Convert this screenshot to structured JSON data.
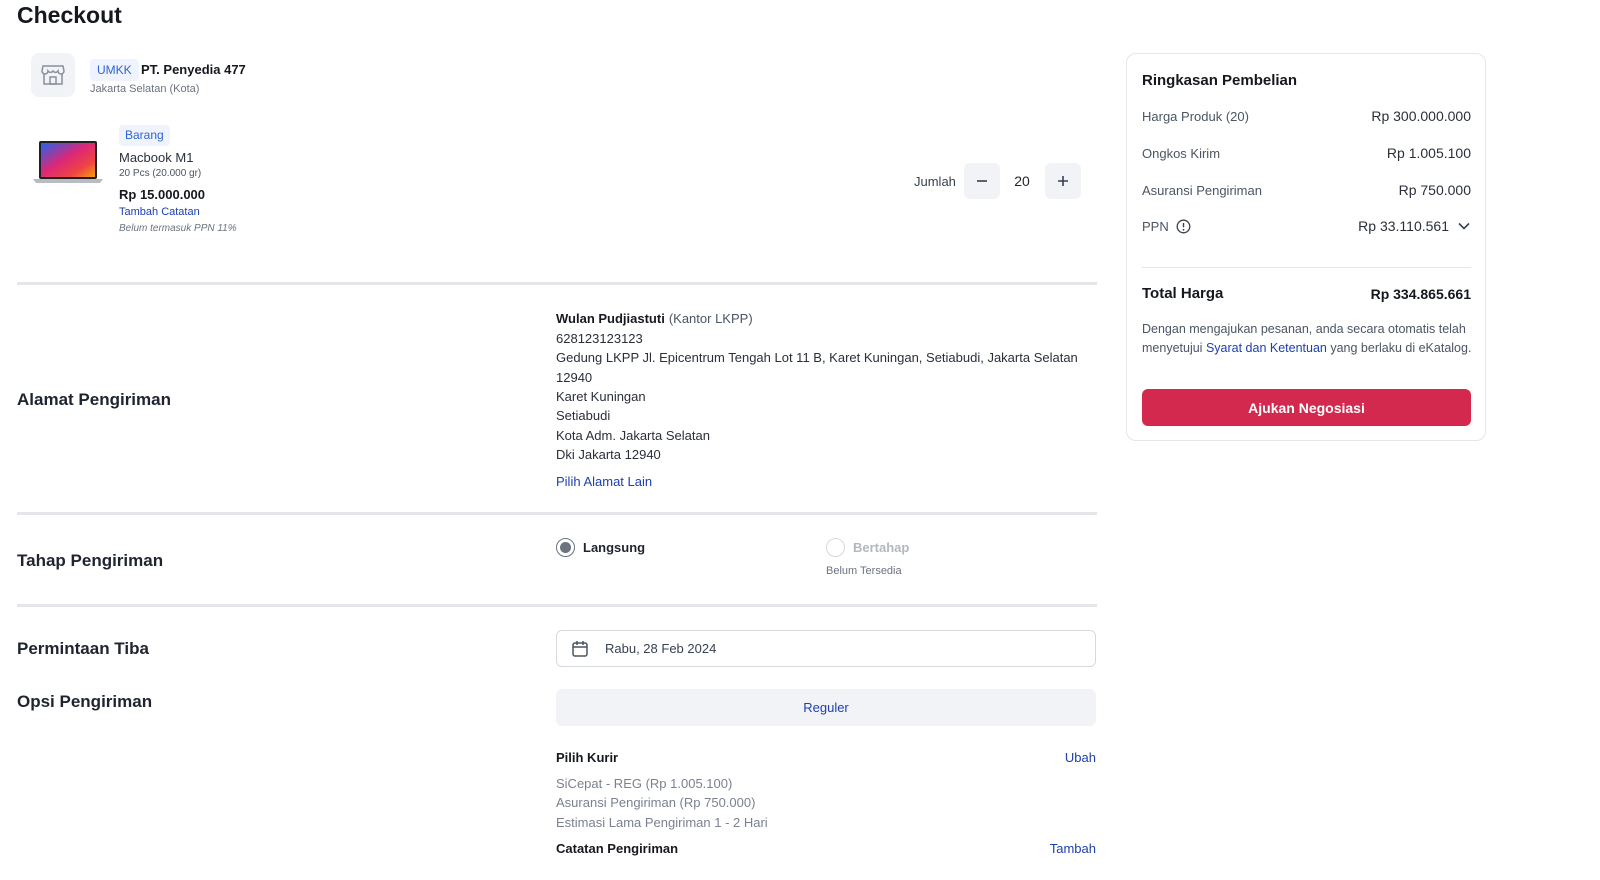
{
  "page": {
    "title": "Checkout"
  },
  "seller": {
    "badge": "UMKK",
    "name": "PT. Penyedia 477",
    "location": "Jakarta Selatan (Kota)"
  },
  "product": {
    "badge": "Barang",
    "name": "Macbook M1",
    "quantity_info": "20 Pcs (20.000 gr)",
    "price": "Rp 15.000.000",
    "add_note": "Tambah Catatan",
    "tax_note": "Belum termasuk PPN 11%",
    "qty_label": "Jumlah",
    "qty_value": "20"
  },
  "address": {
    "section_label": "Alamat Pengiriman",
    "name": "Wulan Pudjiastuti",
    "office": "(Kantor LKPP)",
    "phone": "628123123123",
    "street_line1": "Gedung LKPP Jl. Epicentrum Tengah Lot 11 B, Karet Kuningan, Setiabudi, Jakarta Selatan",
    "street_line2": "12940",
    "village": "Karet Kuningan",
    "district": "Setiabudi",
    "city": "Kota Adm. Jakarta Selatan",
    "province": "Dki Jakarta 12940",
    "change_link": "Pilih Alamat Lain"
  },
  "shipping_stage": {
    "section_label": "Tahap Pengiriman",
    "option_direct": "Langsung",
    "option_staged": "Bertahap",
    "staged_note": "Belum Tersedia"
  },
  "arrival": {
    "section_label": "Permintaan Tiba",
    "date": "Rabu, 28 Feb 2024"
  },
  "shipping_option": {
    "section_label": "Opsi Pengiriman",
    "selected": "Reguler",
    "courier_label": "Pilih Kurir",
    "courier_change": "Ubah",
    "courier_line1": "SiCepat - REG (Rp 1.005.100)",
    "courier_line2": "Asuransi Pengiriman (Rp 750.000)",
    "courier_line3": "Estimasi Lama Pengiriman 1 - 2 Hari",
    "note_label": "Catatan Pengiriman",
    "note_add": "Tambah"
  },
  "summary": {
    "title": "Ringkasan Pembelian",
    "rows": [
      {
        "label": "Harga Produk (20)",
        "value": "Rp 300.000.000"
      },
      {
        "label": "Ongkos Kirim",
        "value": "Rp 1.005.100"
      },
      {
        "label": "Asuransi Pengiriman",
        "value": "Rp 750.000"
      },
      {
        "label": "PPN",
        "value": "Rp 33.110.561"
      }
    ],
    "total_label": "Total Harga",
    "total_value": "Rp 334.865.661",
    "agree_prefix": "Dengan mengajukan pesanan, anda secara otomatis telah menyetujui ",
    "agree_link": "Syarat dan Ketentuan",
    "agree_suffix": " yang berlaku di eKatalog.",
    "submit": "Ajukan Negosiasi"
  },
  "colors": {
    "primary_red": "#d4294f",
    "link_blue": "#1e40af",
    "badge_blue": "#2f66d0"
  },
  "icons": [
    "store-icon",
    "minus-icon",
    "plus-icon",
    "info-icon",
    "chevron-down-icon",
    "calendar-icon"
  ]
}
